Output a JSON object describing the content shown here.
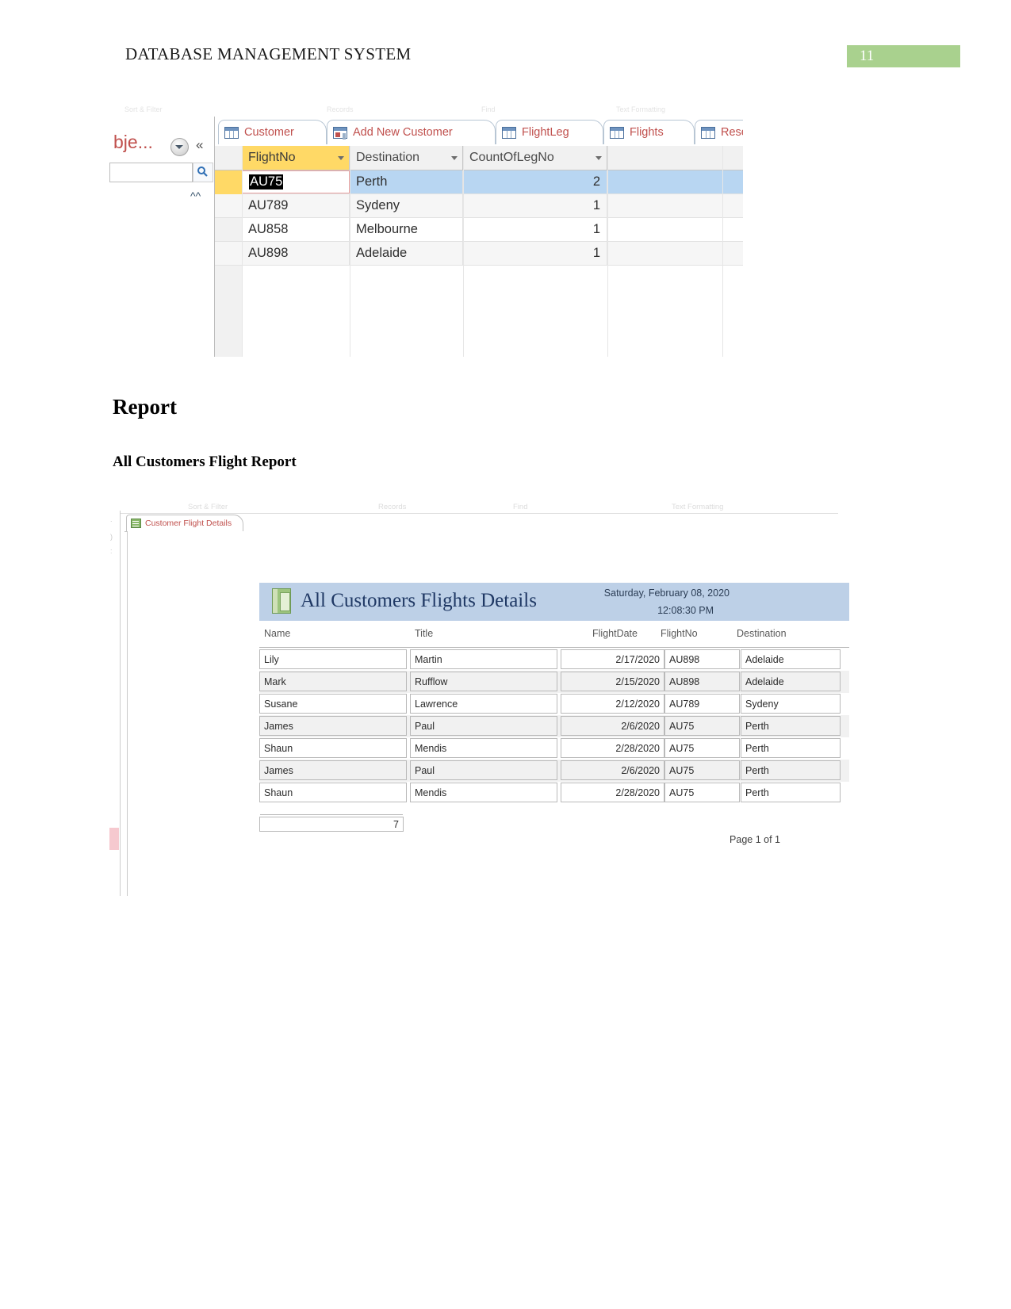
{
  "document": {
    "header_title": "DATABASE MANAGEMENT SYSTEM",
    "page_number": "11",
    "page_badge_color": "#a9d18e",
    "heading_report": "Report",
    "heading_sub": "All Customers Flight Report"
  },
  "datasheet_screenshot": {
    "ghost_labels": [
      "Sort & Filter",
      "Records",
      "Find",
      "Text Formatting"
    ],
    "nav_pane": {
      "title": "bje...",
      "dropdown_icon": "chevron-down-circle-icon",
      "collapse_icon": "double-chevron-left-icon",
      "search_value": "",
      "search_icon": "search-icon",
      "scroll_icon": "double-chevron-up-icon"
    },
    "tabs": [
      {
        "label": "Customer",
        "icon": "table-icon",
        "active": false
      },
      {
        "label": "Add New Customer",
        "icon": "form-icon",
        "active": false
      },
      {
        "label": "FlightLeg",
        "icon": "table-icon",
        "active": false
      },
      {
        "label": "Flights",
        "icon": "table-icon",
        "active": true
      },
      {
        "label": "Reser",
        "icon": "table-icon",
        "active": false
      }
    ],
    "columns": [
      "FlightNo",
      "Destination",
      "CountOfLegNo"
    ],
    "active_column": "FlightNo",
    "rows": [
      {
        "FlightNo": "AU75",
        "Destination": "Perth",
        "CountOfLegNo": "2",
        "selected": true,
        "editing": true
      },
      {
        "FlightNo": "AU789",
        "Destination": "Sydeny",
        "CountOfLegNo": "1",
        "selected": false,
        "editing": false
      },
      {
        "FlightNo": "AU858",
        "Destination": "Melbourne",
        "CountOfLegNo": "1",
        "selected": false,
        "editing": false
      },
      {
        "FlightNo": "AU898",
        "Destination": "Adelaide",
        "CountOfLegNo": "1",
        "selected": false,
        "editing": false
      }
    ]
  },
  "report_screenshot": {
    "ghost_labels": [
      "Sort & Filter",
      "Records",
      "Find",
      "Text Formatting"
    ],
    "ruler_marks": [
      ".",
      ")",
      ":",
      "-"
    ],
    "tab": {
      "label": "Customer Flight Details",
      "icon": "report-icon"
    },
    "report_title": "All Customers Flights Details",
    "report_date": "Saturday, February 08, 2020",
    "report_time": "12:08:30 PM",
    "title_icon": "report-book-icon",
    "columns": [
      "Name",
      "Title",
      "FlightDate",
      "FlightNo",
      "Destination"
    ],
    "rows": [
      {
        "Name": "Lily",
        "Title": "Martin",
        "FlightDate": "2/17/2020",
        "FlightNo": "AU898",
        "Destination": "Adelaide"
      },
      {
        "Name": "Mark",
        "Title": "Rufflow",
        "FlightDate": "2/15/2020",
        "FlightNo": "AU898",
        "Destination": "Adelaide"
      },
      {
        "Name": "Susane",
        "Title": "Lawrence",
        "FlightDate": "2/12/2020",
        "FlightNo": "AU789",
        "Destination": "Sydeny"
      },
      {
        "Name": "James",
        "Title": "Paul",
        "FlightDate": "2/6/2020",
        "FlightNo": "AU75",
        "Destination": "Perth"
      },
      {
        "Name": "Shaun",
        "Title": "Mendis",
        "FlightDate": "2/28/2020",
        "FlightNo": "AU75",
        "Destination": "Perth"
      },
      {
        "Name": "James",
        "Title": "Paul",
        "FlightDate": "2/6/2020",
        "FlightNo": "AU75",
        "Destination": "Perth"
      },
      {
        "Name": "Shaun",
        "Title": "Mendis",
        "FlightDate": "2/28/2020",
        "FlightNo": "AU75",
        "Destination": "Perth"
      }
    ],
    "total_count": "7",
    "page_footer": "Page 1 of 1",
    "header_band_color": "#bdd0e7"
  }
}
